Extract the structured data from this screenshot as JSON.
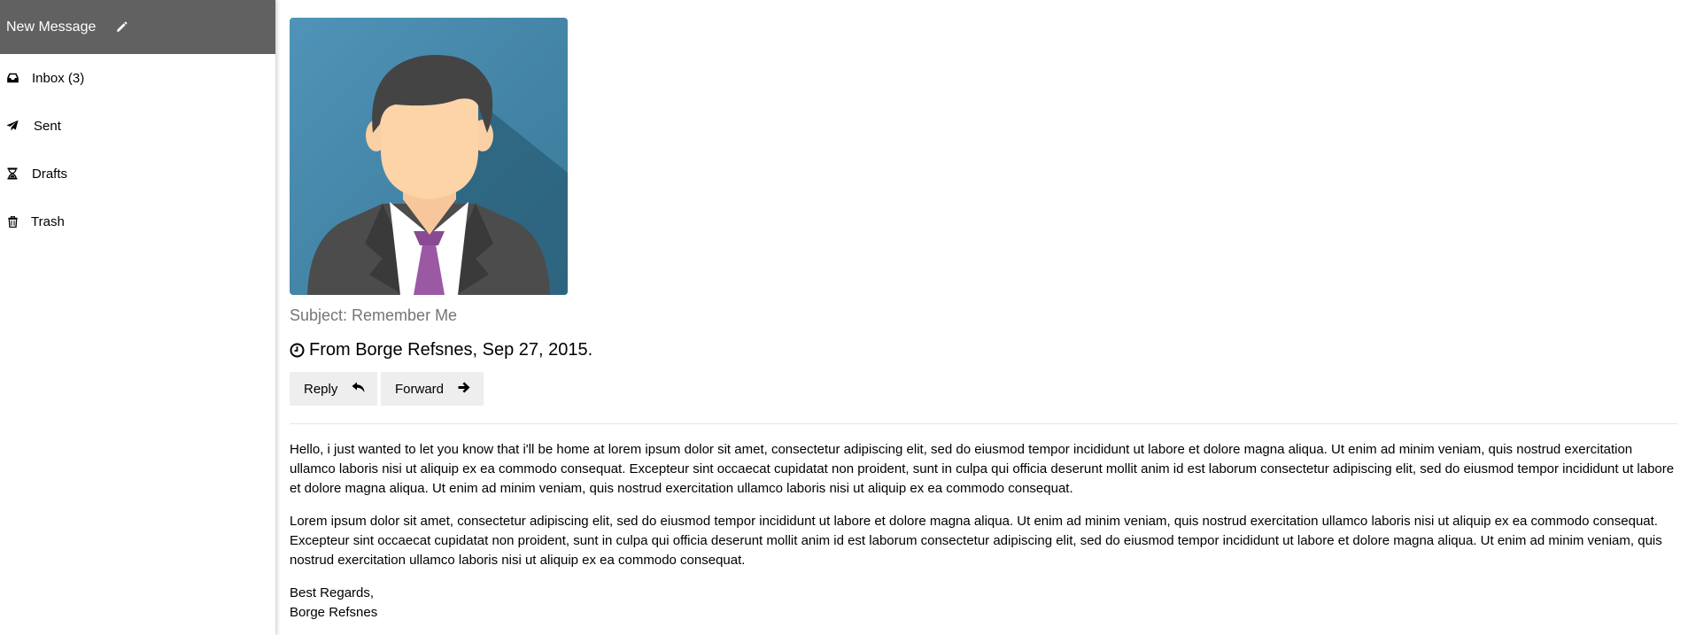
{
  "sidebar": {
    "new_message": "New Message",
    "items": [
      {
        "label": "Inbox (3)",
        "icon": "inbox-icon"
      },
      {
        "label": "Sent",
        "icon": "paper-plane-icon"
      },
      {
        "label": "Drafts",
        "icon": "hourglass-icon"
      },
      {
        "label": "Trash",
        "icon": "trash-icon"
      }
    ]
  },
  "message": {
    "subject": "Subject: Remember Me",
    "from": "From Borge Refsnes, Sep 27, 2015.",
    "reply_label": "Reply",
    "forward_label": "Forward",
    "paragraphs": [
      "Hello, i just wanted to let you know that i'll be home at lorem ipsum dolor sit amet, consectetur adipiscing elit, sed do eiusmod tempor incididunt ut labore et dolore magna aliqua. Ut enim ad minim veniam, quis nostrud exercitation ullamco laboris nisi ut aliquip ex ea commodo consequat. Excepteur sint occaecat cupidatat non proident, sunt in culpa qui officia deserunt mollit anim id est laborum consectetur adipiscing elit, sed do eiusmod tempor incididunt ut labore et dolore magna aliqua. Ut enim ad minim veniam, quis nostrud exercitation ullamco laboris nisi ut aliquip ex ea commodo consequat.",
      "Lorem ipsum dolor sit amet, consectetur adipiscing elit, sed do eiusmod tempor incididunt ut labore et dolore magna aliqua. Ut enim ad minim veniam, quis nostrud exercitation ullamco laboris nisi ut aliquip ex ea commodo consequat. Excepteur sint occaecat cupidatat non proident, sunt in culpa qui officia deserunt mollit anim id est laborum consectetur adipiscing elit, sed do eiusmod tempor incididunt ut labore et dolore magna aliqua. Ut enim ad minim veniam, quis nostrud exercitation ullamco laboris nisi ut aliquip ex ea commodo consequat."
    ],
    "signature_line1": "Best Regards,",
    "signature_line2": "Borge Refsnes"
  },
  "colors": {
    "sidebar_header": "#616161",
    "button_bg": "#eeeeee",
    "subject_text": "#757575",
    "avatar_bg": "#4a8cae",
    "tie": "#9b59a4"
  }
}
